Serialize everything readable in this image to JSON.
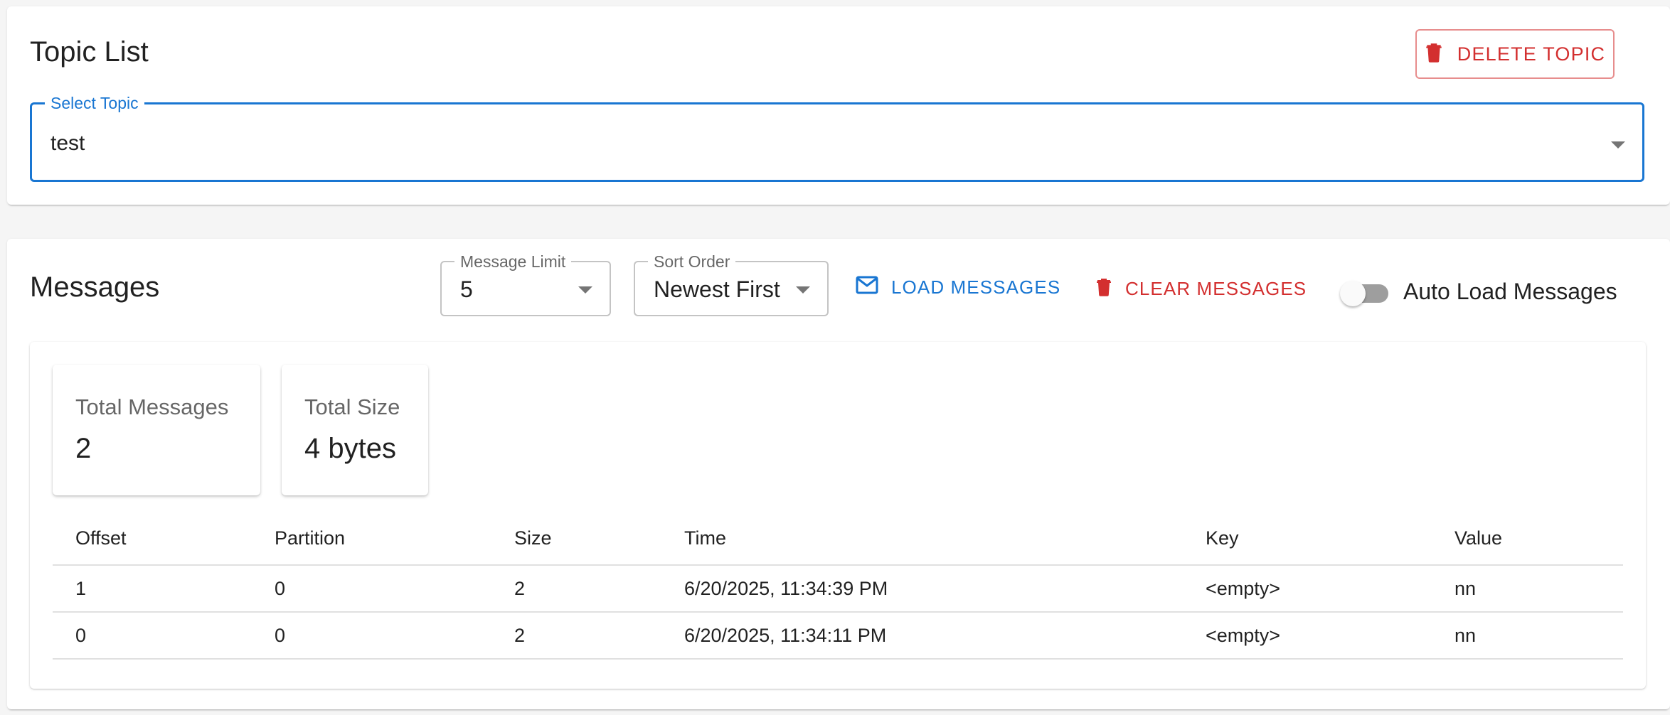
{
  "topic_card": {
    "title": "Topic List",
    "delete_button_label": "DELETE TOPIC",
    "select": {
      "label": "Select Topic",
      "value": "test"
    }
  },
  "messages_card": {
    "title": "Messages",
    "limit_select": {
      "label": "Message Limit",
      "value": "5"
    },
    "sort_select": {
      "label": "Sort Order",
      "value": "Newest First"
    },
    "load_button_label": "LOAD MESSAGES",
    "clear_button_label": "CLEAR MESSAGES",
    "auto_load": {
      "label": "Auto Load Messages",
      "enabled": false
    },
    "stats": {
      "total_messages_label": "Total Messages",
      "total_messages_value": "2",
      "total_size_label": "Total Size",
      "total_size_value": "4 bytes"
    },
    "table": {
      "headers": [
        "Offset",
        "Partition",
        "Size",
        "Time",
        "Key",
        "Value"
      ],
      "rows": [
        [
          "1",
          "0",
          "2",
          "6/20/2025, 11:34:39 PM",
          "<empty>",
          "nn"
        ],
        [
          "0",
          "0",
          "2",
          "6/20/2025, 11:34:11 PM",
          "<empty>",
          "nn"
        ]
      ]
    }
  },
  "colors": {
    "primary": "#1976d2",
    "error": "#d32f2f",
    "switch_off": "#9e9e9e"
  },
  "icons": {
    "delete": "trash-icon",
    "load": "mail-icon",
    "clear": "trash-icon",
    "select_caret": "caret-down-icon"
  }
}
